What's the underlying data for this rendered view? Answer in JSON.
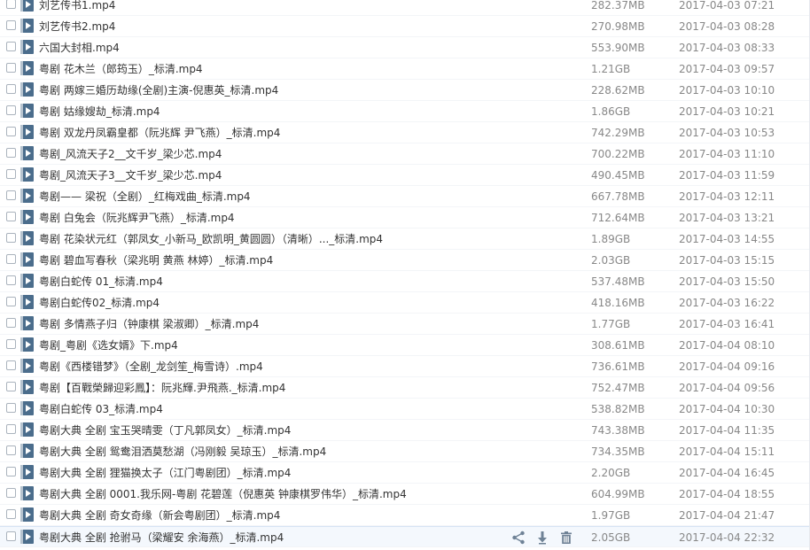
{
  "files": [
    {
      "name": "刘艺传书1.mp4",
      "size": "282.37MB",
      "date": "2017-04-03 07:21"
    },
    {
      "name": "刘艺传书2.mp4",
      "size": "270.98MB",
      "date": "2017-04-03 08:28"
    },
    {
      "name": "六国大封相.mp4",
      "size": "553.90MB",
      "date": "2017-04-03 08:33"
    },
    {
      "name": "粤剧 花木兰（郎筠玉）_标清.mp4",
      "size": "1.21GB",
      "date": "2017-04-03 09:57"
    },
    {
      "name": "粤剧 两嫁三婚历劫缘(全剧)主演-倪惠英_标清.mp4",
      "size": "228.62MB",
      "date": "2017-04-03 10:10"
    },
    {
      "name": "粤剧 姑缘嫂劫_标清.mp4",
      "size": "1.86GB",
      "date": "2017-04-03 10:21"
    },
    {
      "name": "粤剧 双龙丹凤霸皇都（阮兆辉 尹飞燕）_标清.mp4",
      "size": "742.29MB",
      "date": "2017-04-03 10:53"
    },
    {
      "name": "粤剧_风流天子2__文千岁_梁少芯.mp4",
      "size": "700.22MB",
      "date": "2017-04-03 11:10"
    },
    {
      "name": "粤剧_风流天子3__文千岁_梁少芯.mp4",
      "size": "490.45MB",
      "date": "2017-04-03 11:59"
    },
    {
      "name": "粤剧—— 梁祝（全剧）_红梅戏曲_标清.mp4",
      "size": "667.78MB",
      "date": "2017-04-03 12:11"
    },
    {
      "name": "粤剧 白兔会（阮兆辉尹飞燕）_标清.mp4",
      "size": "712.64MB",
      "date": "2017-04-03 13:21"
    },
    {
      "name": "粤剧  花染状元红（郭凤女_小新马_欧凯明_黄圆圆）（清晰）..._标清.mp4",
      "size": "1.89GB",
      "date": "2017-04-03 14:55"
    },
    {
      "name": "粤剧 碧血写春秋（梁兆明 黄燕 林婷）_标清.mp4",
      "size": "2.03GB",
      "date": "2017-04-03 15:15"
    },
    {
      "name": "粤剧白蛇传 01_标清.mp4",
      "size": "537.48MB",
      "date": "2017-04-03 15:50"
    },
    {
      "name": "粤剧白蛇传02_标清.mp4",
      "size": "418.16MB",
      "date": "2017-04-03 16:22"
    },
    {
      "name": "粤剧 多情燕子归（钟康棋 梁淑卿）_标清.mp4",
      "size": "1.77GB",
      "date": "2017-04-03 16:41"
    },
    {
      "name": "粤剧_粤剧《选女婿》下.mp4",
      "size": "308.61MB",
      "date": "2017-04-04 08:10"
    },
    {
      "name": "粤剧《西楼错梦》（全剧_龙剑笙_梅雪诗）.mp4",
      "size": "736.61MB",
      "date": "2017-04-04 09:16"
    },
    {
      "name": "粤剧【百戰榮歸迎彩鳳】：阮兆輝.尹飛燕._标清.mp4",
      "size": "752.47MB",
      "date": "2017-04-04 09:56"
    },
    {
      "name": "粤剧白蛇传 03_标清.mp4",
      "size": "538.82MB",
      "date": "2017-04-04 10:30"
    },
    {
      "name": "粤剧大典  全剧   宝玉哭晴雯（丁凡郭凤女）_标清.mp4",
      "size": "743.38MB",
      "date": "2017-04-04 11:35"
    },
    {
      "name": "粤剧大典  全剧   鸳鸯泪洒莫愁湖（冯刚毅 吴琼玉）_标清.mp4",
      "size": "734.35MB",
      "date": "2017-04-04 15:11"
    },
    {
      "name": "粤剧大典  全剧   狸猫换太子（江门粤剧团）_标清.mp4",
      "size": "2.20GB",
      "date": "2017-04-04 16:45"
    },
    {
      "name": "粤剧大典  全剧   0001.我乐网-粤剧 花碧莲（倪惠英 钟康棋罗伟华）_标清.mp4",
      "size": "604.99MB",
      "date": "2017-04-04 18:55"
    },
    {
      "name": "粤剧大典  全剧   奇女奇缘（新会粤剧团）_标清.mp4",
      "size": "1.97GB",
      "date": "2017-04-04 21:47"
    },
    {
      "name": "粤剧大典  全剧   抢驸马（梁耀安 余海燕）_标清.mp4",
      "size": "2.05GB",
      "date": "2017-04-04 22:32"
    }
  ],
  "row_actions": {
    "share_icon": "share-icon",
    "download_icon": "download-icon",
    "delete_icon": "trash-icon"
  },
  "colors": {
    "name_text": "#333333",
    "meta_text": "#888888",
    "icon_fill": "#4b6d8c",
    "action_icon": "#6f8296",
    "hover_row": "#f4f8fd"
  }
}
